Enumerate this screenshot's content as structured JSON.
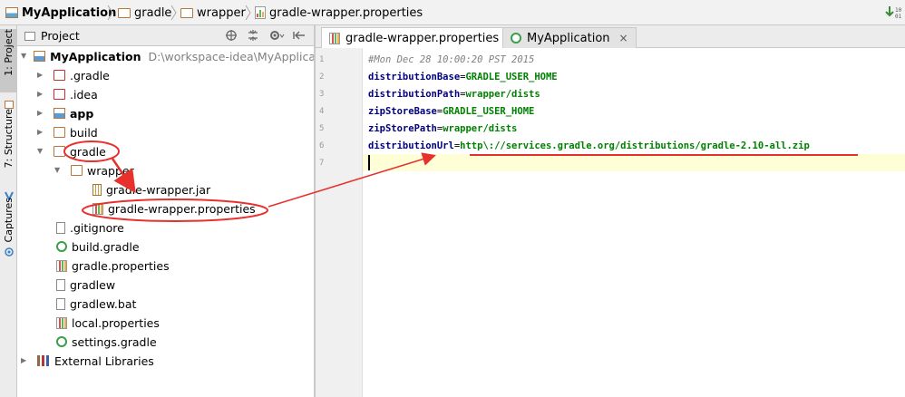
{
  "breadcrumbs": [
    "MyApplication",
    "gradle",
    "wrapper",
    "gradle-wrapper.properties"
  ],
  "navbar_right_glyph": "10\n01",
  "tool_stripe": {
    "project_tab": "1: Project",
    "structure_tab": "7: Structure",
    "captures_tab": "Captures"
  },
  "project_panel": {
    "view_selector": "Project",
    "tree": [
      {
        "label": "MyApplication",
        "path": "D:\\workspace-idea\\MyApplicatio",
        "icon": "project-folder-icon"
      },
      {
        "label": ".gradle",
        "icon": "folder-icon"
      },
      {
        "label": ".idea",
        "icon": "folder-icon"
      },
      {
        "label": "app",
        "icon": "module-folder-icon"
      },
      {
        "label": "build",
        "icon": "folder-icon"
      },
      {
        "label": "gradle",
        "icon": "folder-icon"
      },
      {
        "label": "wrapper",
        "icon": "folder-icon"
      },
      {
        "label": "gradle-wrapper.jar",
        "icon": "jar-icon"
      },
      {
        "label": "gradle-wrapper.properties",
        "icon": "properties-icon"
      },
      {
        "label": ".gitignore",
        "icon": "file-icon"
      },
      {
        "label": "build.gradle",
        "icon": "gradle-icon"
      },
      {
        "label": "gradle.properties",
        "icon": "properties-icon"
      },
      {
        "label": "gradlew",
        "icon": "file-icon"
      },
      {
        "label": "gradlew.bat",
        "icon": "file-icon"
      },
      {
        "label": "local.properties",
        "icon": "properties-icon"
      },
      {
        "label": "settings.gradle",
        "icon": "gradle-icon"
      },
      {
        "label": "External Libraries",
        "icon": "libraries-icon"
      }
    ]
  },
  "editor": {
    "tabs": [
      {
        "label": "gradle-wrapper.properties",
        "close": "×",
        "active": true
      },
      {
        "label": "MyApplication",
        "close": "×",
        "active": false
      }
    ],
    "line_numbers": [
      "1",
      "2",
      "3",
      "4",
      "5",
      "6",
      "7"
    ],
    "lines": [
      {
        "comment": "#Mon Dec 28 10:00:20 PST 2015"
      },
      {
        "key": "distributionBase",
        "eq": "=",
        "value": "GRADLE_USER_HOME"
      },
      {
        "key": "distributionPath",
        "eq": "=",
        "value": "wrapper/dists"
      },
      {
        "key": "zipStoreBase",
        "eq": "=",
        "value": "GRADLE_USER_HOME"
      },
      {
        "key": "zipStorePath",
        "eq": "=",
        "value": "wrapper/dists"
      },
      {
        "key": "distributionUrl",
        "eq": "=",
        "value": "http\\://services.gradle.org/distributions/gradle-2.10-all.zip"
      }
    ]
  },
  "colors": {
    "annotation": "#e8302c",
    "key": "#000080",
    "value": "#008000",
    "comment": "#808080",
    "caret_line": "#ffffd7"
  }
}
